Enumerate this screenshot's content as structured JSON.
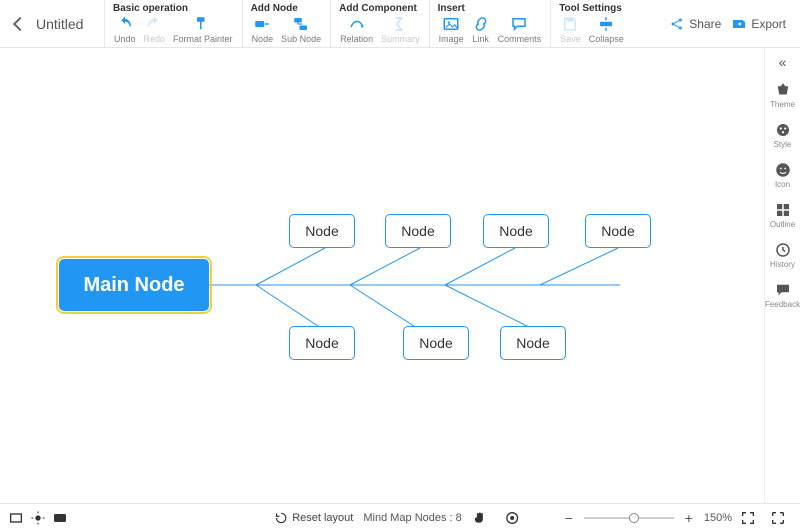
{
  "header": {
    "doc_title": "Untitled",
    "groups": {
      "basic": {
        "title": "Basic operation",
        "undo": "Undo",
        "redo": "Redo",
        "format_painter": "Format Painter"
      },
      "addnode": {
        "title": "Add Node",
        "node": "Node",
        "subnode": "Sub Node"
      },
      "addcomp": {
        "title": "Add Component",
        "relation": "Relation",
        "summary": "Summary"
      },
      "insert": {
        "title": "Insert",
        "image": "Image",
        "link": "Link",
        "comments": "Comments"
      },
      "toolset": {
        "title": "Tool Settings",
        "save": "Save",
        "collapse": "Collapse"
      }
    },
    "share": "Share",
    "export": "Export"
  },
  "sidebar": {
    "theme": "Theme",
    "style": "Style",
    "icon": "Icon",
    "outline": "Outline",
    "history": "History",
    "feedback": "Feedback"
  },
  "canvas": {
    "main": "Main Node",
    "nodes_top": [
      "Node",
      "Node",
      "Node",
      "Node"
    ],
    "nodes_bottom": [
      "Node",
      "Node",
      "Node"
    ]
  },
  "status": {
    "reset": "Reset layout",
    "count_label": "Mind Map Nodes :",
    "count": "8",
    "zoom": "150%",
    "minus": "−",
    "plus": "+"
  },
  "colors": {
    "accent": "#2196f3"
  }
}
